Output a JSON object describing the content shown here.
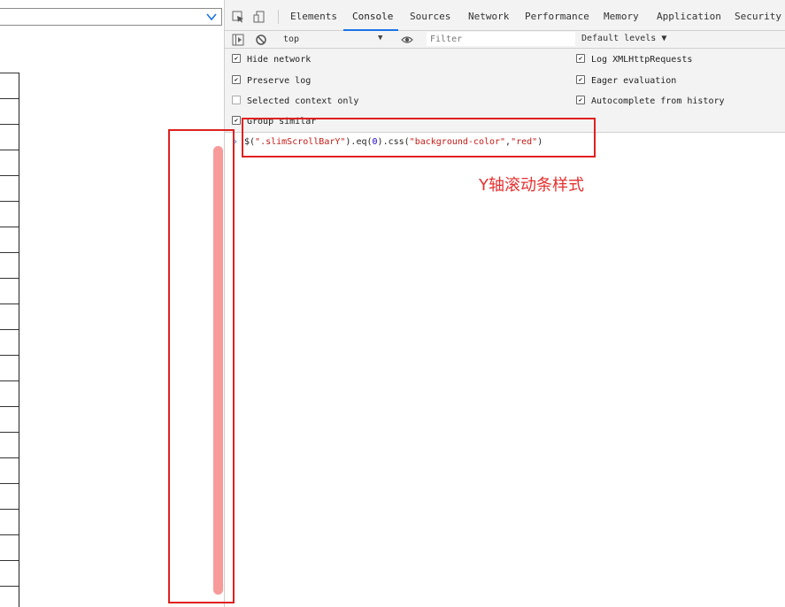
{
  "devtools": {
    "tabs": [
      "Elements",
      "Console",
      "Sources",
      "Network",
      "Performance",
      "Memory",
      "Application",
      "Security"
    ],
    "active_tab": "Console",
    "toolbar": {
      "context": "top",
      "filter_placeholder": "Filter",
      "levels": "Default levels"
    },
    "settings": {
      "left": [
        {
          "label": "Hide network",
          "checked": true
        },
        {
          "label": "Preserve log",
          "checked": true
        },
        {
          "label": "Selected context only",
          "checked": false
        },
        {
          "label": "Group similar",
          "checked": true
        }
      ],
      "right": [
        {
          "label": "Log XMLHttpRequests",
          "checked": true
        },
        {
          "label": "Eager evaluation",
          "checked": true
        },
        {
          "label": "Autocomplete from history",
          "checked": true
        }
      ]
    },
    "console_input": {
      "prefix": "$(",
      "selector": "\".slimScrollBarY\"",
      "mid1": ").eq(",
      "index": "0",
      "mid2": ").css(",
      "prop": "\"background-color\"",
      "comma": ",",
      "value": "\"red\"",
      "suffix": ")"
    }
  },
  "annotation": {
    "label": "Y轴滚动条样式",
    "color": "#e02020"
  },
  "scrollbar": {
    "color": "#f79a9a"
  }
}
